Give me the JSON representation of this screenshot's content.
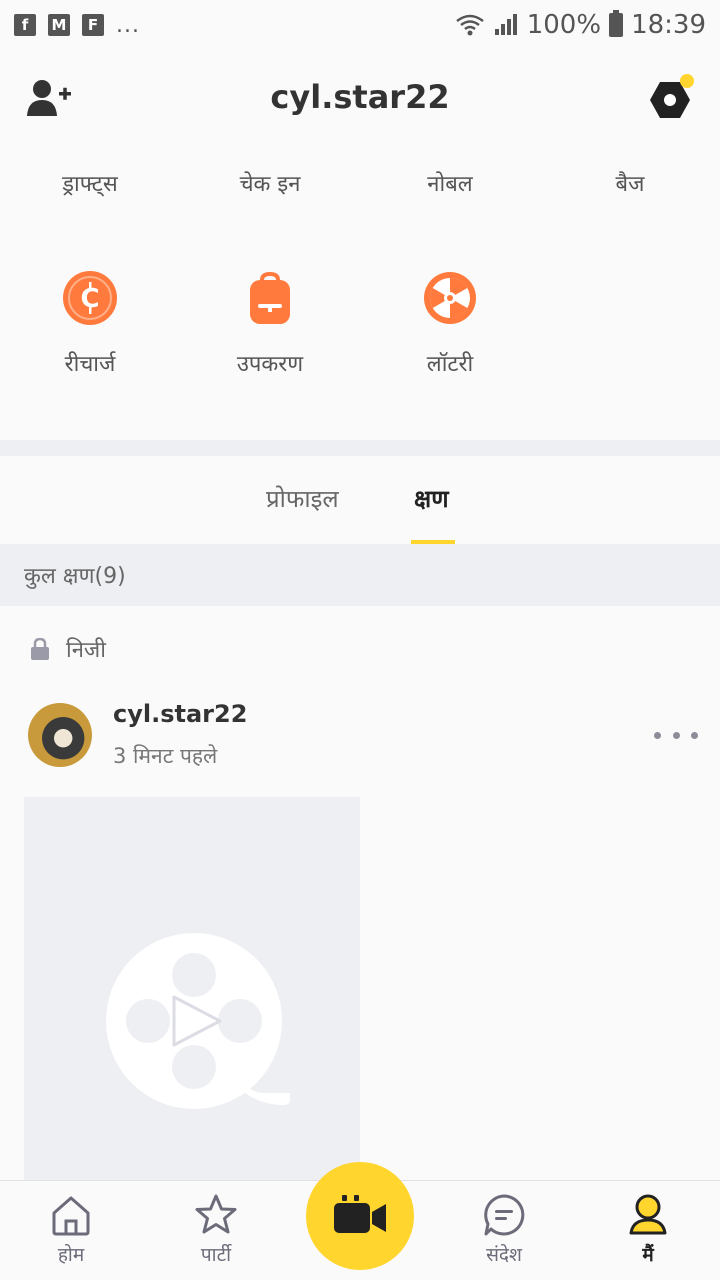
{
  "status_bar": {
    "notification_icons": [
      "facebook-icon",
      "gmail-icon",
      "flipboard-icon"
    ],
    "more": "...",
    "battery": "100%",
    "time": "18:39"
  },
  "header": {
    "title": "cyl.star22"
  },
  "grid": {
    "row1": [
      {
        "label": "ड्राफ्ट्स"
      },
      {
        "label": "चेक इन"
      },
      {
        "label": "नोबल"
      },
      {
        "label": "बैज"
      }
    ],
    "row2": [
      {
        "label": "रीचार्ज",
        "icon": "coin-icon"
      },
      {
        "label": "उपकरण",
        "icon": "backpack-icon"
      },
      {
        "label": "लॉटरी",
        "icon": "lottery-wheel-icon"
      }
    ]
  },
  "tabs": {
    "profile": "प्रोफाइल",
    "moments": "क्षण"
  },
  "moments": {
    "total": "कुल क्षण(9)",
    "privacy": "निजी",
    "post": {
      "username": "cyl.star22",
      "time": "3 मिनट पहले"
    }
  },
  "bottom_nav": {
    "home": "होम",
    "party": "पार्टी",
    "messages": "संदेश",
    "me": "मैं"
  },
  "colors": {
    "accent_yellow": "#ffd52e",
    "orange": "#ff7a3c",
    "band_gray": "#eeeff3"
  }
}
